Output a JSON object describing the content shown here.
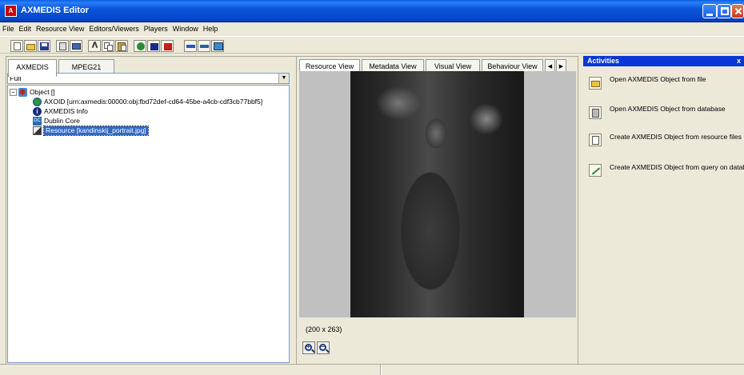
{
  "window": {
    "title": "AXMEDIS Editor"
  },
  "menu": [
    "File",
    "Edit",
    "Resource View",
    "Editors/Viewers",
    "Players",
    "Window",
    "Help"
  ],
  "left_panel": {
    "tabs": [
      "AXMEDIS",
      "MPEG21"
    ],
    "view_select": "Full",
    "tree": {
      "root": "Object []",
      "children": [
        "AXOID [urn:axmedis:00000:obj:fbd72def-cd64-45be-a4cb-cdf3cb77bbf5]",
        "AXMEDIS Info",
        "Dublin Core",
        "Resource [kandinskij_portrait.jpg]"
      ]
    }
  },
  "center_panel": {
    "tabs": [
      "Resource View",
      "Metadata View",
      "Visual View",
      "Behaviour View"
    ],
    "image_size": "(200 x 263)"
  },
  "activities": {
    "title": "Activities",
    "close": "x",
    "items": [
      "Open AXMEDIS Object from file",
      "Open AXMEDIS Object from database",
      "Create AXMEDIS Object from resource files",
      "Create AXMEDIS Object from query on databas"
    ]
  }
}
